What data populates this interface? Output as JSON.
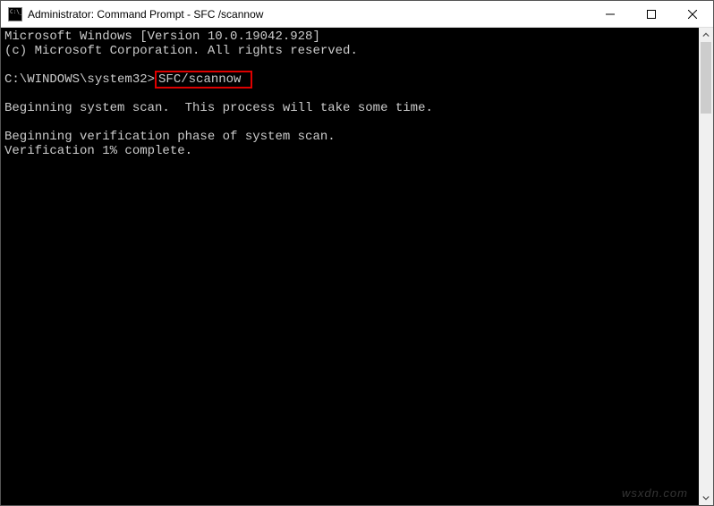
{
  "window": {
    "title": "Administrator: Command Prompt - SFC /scannow"
  },
  "terminal": {
    "line1": "Microsoft Windows [Version 10.0.19042.928]",
    "line2": "(c) Microsoft Corporation. All rights reserved.",
    "blank1": "",
    "prompt_prefix": "C:\\WINDOWS\\system32>",
    "command": "SFC/scannow",
    "blank2": "",
    "line3": "Beginning system scan.  This process will take some time.",
    "blank3": "",
    "line4": "Beginning verification phase of system scan.",
    "line5": "Verification 1% complete."
  },
  "watermark": "wsxdn.com"
}
